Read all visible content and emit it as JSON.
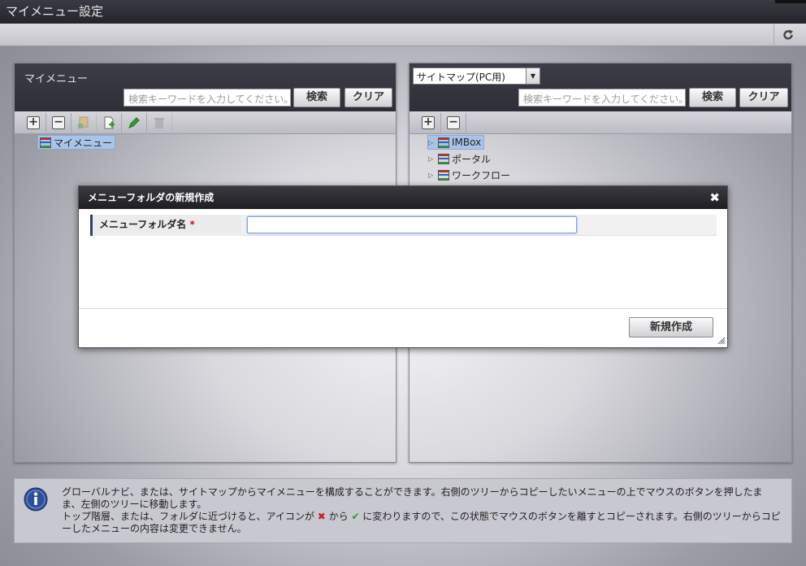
{
  "window": {
    "title": "マイメニュー設定"
  },
  "toolbar": {
    "reload_icon": "reload-icon"
  },
  "left_panel": {
    "title": "マイメニュー",
    "search_placeholder": "検索キーワードを入力してください。",
    "search_label": "検索",
    "clear_label": "クリア",
    "tree_tools": [
      "add-icon",
      "remove-icon",
      "add-folder-icon",
      "add-item-icon",
      "edit-icon",
      "delete-icon"
    ],
    "tree": [
      {
        "label": "マイメニュー"
      }
    ]
  },
  "right_panel": {
    "select_value": "サイトマップ(PC用)",
    "search_placeholder": "検索キーワードを入力してください。",
    "search_label": "検索",
    "clear_label": "クリア",
    "tree_tools": [
      "expand-all-icon",
      "collapse-all-icon"
    ],
    "tree": [
      {
        "label": "IMBox"
      },
      {
        "label": "ポータル"
      },
      {
        "label": "ワークフロー"
      }
    ]
  },
  "dialog": {
    "title": "メニューフォルダの新規作成",
    "field_label": "メニューフォルダ名",
    "required_mark": "*",
    "field_value": "",
    "create_label": "新規作成"
  },
  "info": {
    "line1": "グローバルナビ、または、サイトマップからマイメニューを構成することができます。右側のツリーからコピーしたいメニューの上でマウスのボタンを押したまま、左側のツリーに移動します。",
    "line2_a": "トップ階層、または、フォルダに近づけると、アイコンが",
    "line2_b": "から",
    "line2_c": "に変わりますので、この状態でマウスのボタンを離すとコピーされます。右側のツリーからコピーしたメニューの内容は変更できません。"
  },
  "colors": {
    "header_dark": "#2e2e37",
    "selection": "#a9c4e8",
    "required": "#d01010",
    "label_border": "#2c3e6a"
  }
}
